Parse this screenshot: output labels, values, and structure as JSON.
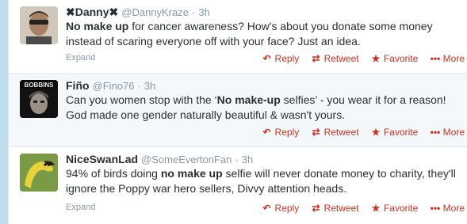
{
  "tweets": [
    {
      "fullname": "✖Danny✖",
      "username": "@DannyKraze",
      "time": "3h",
      "text_parts": [
        "No make up",
        " for cancer awareness? How's about you donate some money instead of scaring everyone off with your face? Just an idea."
      ],
      "expand": "Expand",
      "avatar_icon": "man-with-sunglasses-avatar"
    },
    {
      "fullname": "Fiño",
      "username": "@Fino76",
      "time": "3h",
      "text_parts": [
        "Can you women stop with the ‘",
        "No make-up",
        " selfies’ - you wear it for a reason! God made one gender naturally beautiful & wasn't yours."
      ],
      "expand": "",
      "avatar_icon": "bobbins-avatar",
      "avatar_text": "BOBBINS"
    },
    {
      "fullname": "NiceSwanLad",
      "username": "@SomeEvertonFan",
      "time": "3h",
      "text_parts": [
        "94% of birds doing ",
        "no make up",
        " selfie will never donate money to charity, they'll ignore the Poppy war hero sellers, Divvy attention heads."
      ],
      "expand": "Expand",
      "avatar_icon": "swan-avatar"
    }
  ],
  "actions": {
    "reply": "Reply",
    "retweet": "Retweet",
    "favorite": "Favorite",
    "more": "More"
  },
  "colors": {
    "action": "#cc3322",
    "muted": "#8899a6",
    "text": "#292f33"
  }
}
